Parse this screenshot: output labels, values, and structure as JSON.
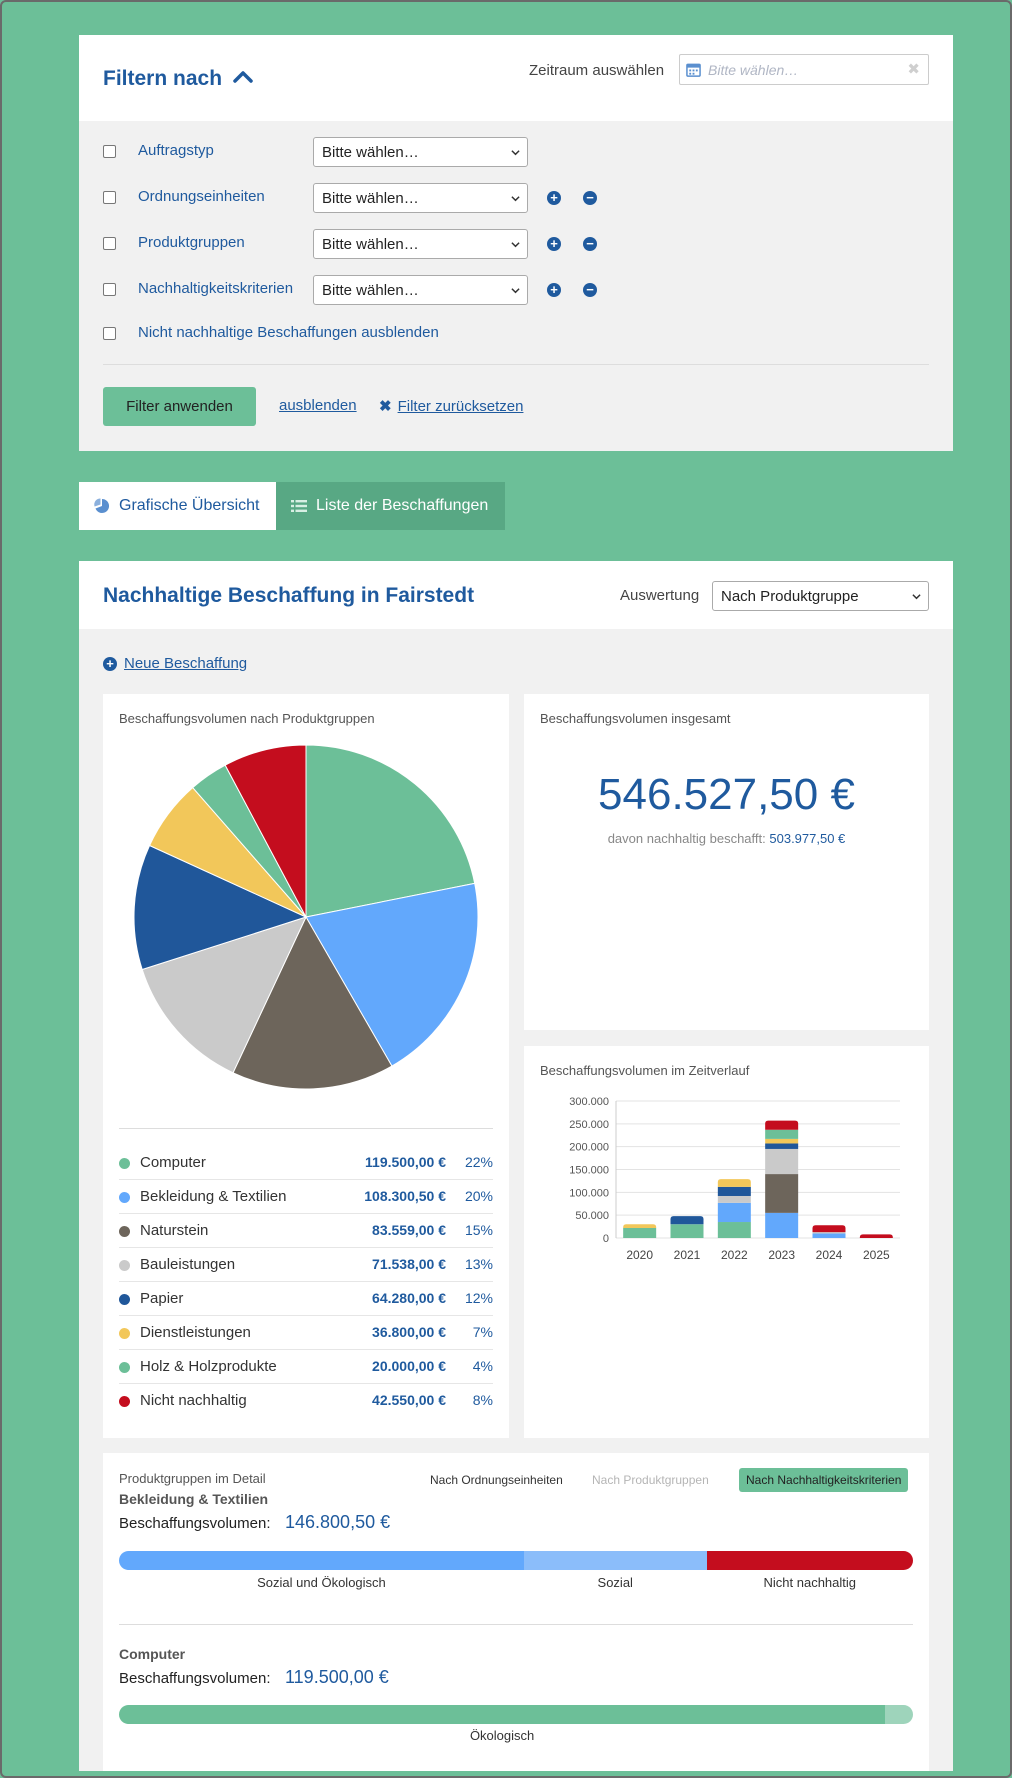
{
  "filter": {
    "title": "Filtern nach",
    "zeitraum_label": "Zeitraum auswählen",
    "date_placeholder": "Bitte wählen…",
    "rows": [
      {
        "label": "Auftragstyp",
        "select": "Bitte wählen…",
        "plusminus": false
      },
      {
        "label": "Ordnungseinheiten",
        "select": "Bitte wählen…",
        "plusminus": true
      },
      {
        "label": "Produktgruppen",
        "select": "Bitte wählen…",
        "plusminus": true
      },
      {
        "label": "Nachhaltigkeitskriterien",
        "select": "Bitte wählen…",
        "plusminus": true
      }
    ],
    "hide_unsustainable": "Nicht nachhaltige Beschaffungen ausblenden",
    "apply": "Filter anwenden",
    "hide": "ausblenden",
    "reset": "Filter zurücksetzen"
  },
  "tabs": {
    "graph": "Grafische Übersicht",
    "list": "Liste der Beschaffungen"
  },
  "main": {
    "title": "Nachhaltige Beschaffung in Fairstedt",
    "auswertung_label": "Auswertung",
    "auswertung_value": "Nach Produktgruppe",
    "new_label": "Neue Beschaffung"
  },
  "pie_panel": {
    "title": "Beschaffungsvolumen nach Produktgruppen"
  },
  "total_panel": {
    "title": "Beschaffungsvolumen insgesamt",
    "total": "546.527,50 €",
    "sub_label": "davon nachhaltig beschafft:",
    "sub_value": "503.977,50 €"
  },
  "time_panel": {
    "title": "Beschaffungsvolumen im Zeitverlauf"
  },
  "chart_data": [
    {
      "type": "pie",
      "title": "Beschaffungsvolumen nach Produktgruppen",
      "slices": [
        {
          "name": "Computer",
          "value": 119500.0,
          "value_text": "119.500,00 €",
          "pct": "22%",
          "color": "#6cbf98"
        },
        {
          "name": "Bekleidung & Textilien",
          "value": 108300.5,
          "value_text": "108.300,50 €",
          "pct": "20%",
          "color": "#62a8fc"
        },
        {
          "name": "Naturstein",
          "value": 83559.0,
          "value_text": "83.559,00 €",
          "pct": "15%",
          "color": "#6d655b"
        },
        {
          "name": "Bauleistungen",
          "value": 71538.0,
          "value_text": "71.538,00 €",
          "pct": "13%",
          "color": "#cacaca"
        },
        {
          "name": "Papier",
          "value": 64280.0,
          "value_text": "64.280,00 €",
          "pct": "12%",
          "color": "#20579a"
        },
        {
          "name": "Dienstleistungen",
          "value": 36800.0,
          "value_text": "36.800,00 €",
          "pct": "7%",
          "color": "#f2c75a"
        },
        {
          "name": "Holz & Holzprodukte",
          "value": 20000.0,
          "value_text": "20.000,00 €",
          "pct": "4%",
          "color": "#6cbf98"
        },
        {
          "name": "Nicht nachhaltig",
          "value": 42550.0,
          "value_text": "42.550,00 €",
          "pct": "8%",
          "color": "#c40d1e"
        }
      ]
    },
    {
      "type": "bar",
      "stacked": true,
      "title": "Beschaffungsvolumen im Zeitverlauf",
      "categories": [
        "2020",
        "2021",
        "2022",
        "2023",
        "2024",
        "2025"
      ],
      "ylim": [
        0,
        300000
      ],
      "yticks": [
        0,
        50000,
        100000,
        150000,
        200000,
        250000,
        300000
      ],
      "ytick_labels": [
        "0",
        "50.000",
        "100.000",
        "150.000",
        "200.000",
        "250.000",
        "300.000"
      ],
      "grid": true,
      "series": [
        {
          "color": "#6cbf98",
          "values": [
            22000,
            30000,
            35000,
            0,
            0,
            0
          ]
        },
        {
          "color": "#62a8fc",
          "values": [
            0,
            0,
            42000,
            55000,
            10000,
            0
          ]
        },
        {
          "color": "#6d655b",
          "values": [
            0,
            0,
            0,
            85000,
            0,
            0
          ]
        },
        {
          "color": "#cacaca",
          "values": [
            0,
            0,
            15000,
            55000,
            3000,
            0
          ]
        },
        {
          "color": "#20579a",
          "values": [
            0,
            18000,
            20000,
            12000,
            0,
            0
          ]
        },
        {
          "color": "#f2c75a",
          "values": [
            8000,
            0,
            17000,
            10000,
            0,
            0
          ]
        },
        {
          "color": "#6cbf98",
          "values": [
            0,
            0,
            0,
            20000,
            0,
            0
          ]
        },
        {
          "color": "#c40d1e",
          "values": [
            0,
            0,
            0,
            20000,
            15000,
            8000
          ]
        }
      ]
    }
  ],
  "detail": {
    "label": "Produktgruppen im Detail",
    "tabs": [
      {
        "label": "Nach Ordnungseinheiten",
        "state": "normal"
      },
      {
        "label": "Nach Produktgruppen",
        "state": "disabled"
      },
      {
        "label": "Nach Nachhaltigkeitskriterien",
        "state": "active"
      }
    ],
    "volume_label": "Beschaffungsvolumen:",
    "groups": [
      {
        "name": "Bekleidung & Textilien",
        "volume": "146.800,50 €",
        "segments": [
          {
            "label": "Sozial und Ökologisch",
            "share": 0.51,
            "color": "#62a8fc"
          },
          {
            "label": "Sozial",
            "share": 0.23,
            "color": "#8bbdfa"
          },
          {
            "label": "Nicht nachhaltig",
            "share": 0.26,
            "color": "#c40d1e"
          }
        ]
      },
      {
        "name": "Computer",
        "volume": "119.500,00 €",
        "segments": [
          {
            "label": "Ökologisch",
            "share": 0.965,
            "color": "#6cbf98"
          },
          {
            "label": "",
            "share": 0.035,
            "color": "#9ed4bb"
          }
        ]
      }
    ]
  }
}
